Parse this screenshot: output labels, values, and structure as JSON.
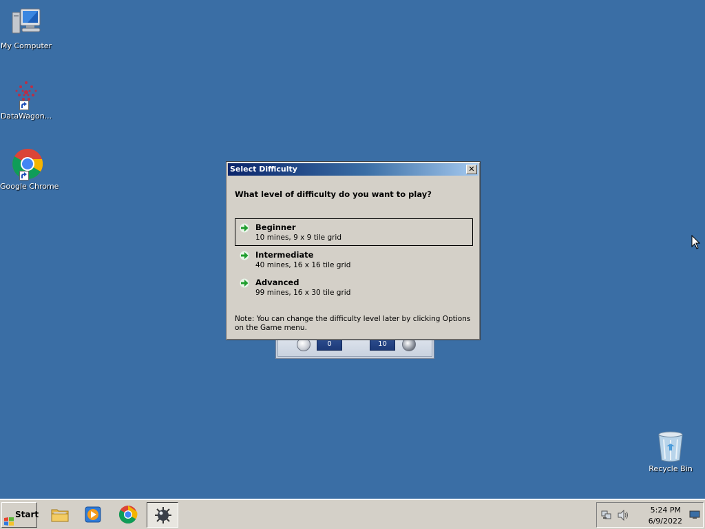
{
  "desktop": {
    "icons": [
      {
        "label": "My Computer",
        "icon": "computer-icon"
      },
      {
        "label": "DataWagon...",
        "icon": "datawagon-icon"
      },
      {
        "label": "Google Chrome",
        "icon": "chrome-icon"
      }
    ],
    "recycle_bin": {
      "label": "Recycle Bin",
      "icon": "recycle-bin-icon"
    }
  },
  "game_window": {
    "time_counter": "0",
    "mine_counter": "10"
  },
  "dialog": {
    "title": "Select Difficulty",
    "close_label": "✕",
    "question": "What level of difficulty do you want to play?",
    "options": [
      {
        "title": "Beginner",
        "description": "10 mines, 9 x 9 tile grid",
        "selected": true
      },
      {
        "title": "Intermediate",
        "description": "40 mines, 16 x 16 tile grid",
        "selected": false
      },
      {
        "title": "Advanced",
        "description": "99 mines, 16 x 30 tile grid",
        "selected": false
      }
    ],
    "note": "Note: You can change the difficulty level later by clicking Options on the Game menu."
  },
  "taskbar": {
    "start_label": "Start",
    "apps": [
      {
        "name": "file-explorer",
        "icon": "folder-icon",
        "active": false
      },
      {
        "name": "media-player",
        "icon": "media-player-icon",
        "active": false
      },
      {
        "name": "google-chrome",
        "icon": "chrome-icon",
        "active": false
      },
      {
        "name": "minesweeper",
        "icon": "minesweeper-icon",
        "active": true
      }
    ],
    "tray": {
      "time": "5:24 PM",
      "date": "6/9/2022",
      "icons": [
        "network-icon",
        "volume-icon",
        "show-desktop-icon"
      ]
    }
  },
  "colors": {
    "desktop_background": "#3a6ea5",
    "dialog_face": "#d4d0c8",
    "titlebar_start": "#0a246a",
    "titlebar_end": "#a6caf0",
    "arrow_green": "#1f9e2e"
  }
}
